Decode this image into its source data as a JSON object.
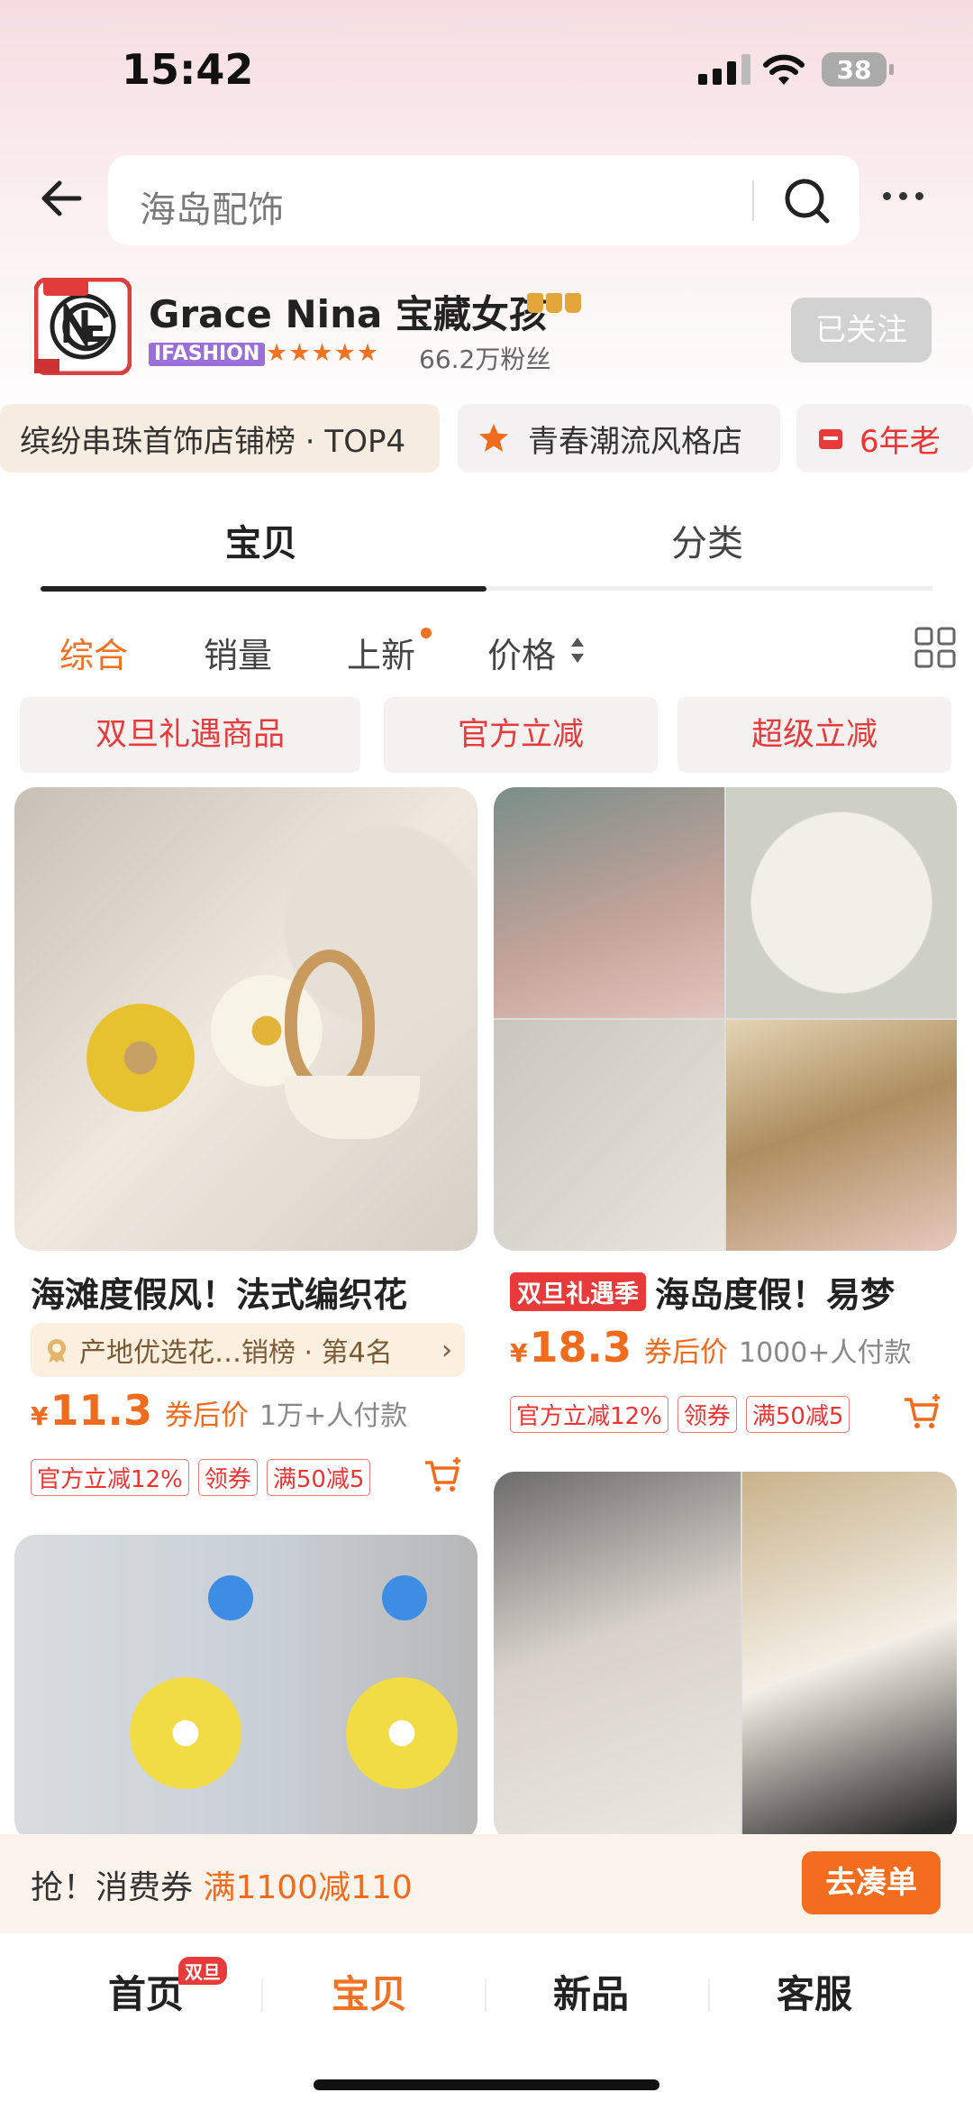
{
  "status_bar": {
    "time": "15:42",
    "battery": "38"
  },
  "search": {
    "query": "海岛配饰"
  },
  "shop": {
    "name": "Grace Nina 宝藏女孩",
    "platform_tag": "IFASHION",
    "stars": "★★★★★",
    "fans": "66.2万粉丝",
    "follow_label": "已关注"
  },
  "badges": [
    {
      "label": "缤纷串珠首饰店铺榜 · TOP4"
    },
    {
      "label": "青春潮流风格店",
      "icon": "star-icon"
    },
    {
      "label": "6年老",
      "icon": "store-icon"
    }
  ],
  "tabs": [
    {
      "label": "宝贝"
    },
    {
      "label": "分类"
    }
  ],
  "sort": {
    "zonghe": "综合",
    "xiaoliang": "销量",
    "shangxin": "上新",
    "jiage": "价格"
  },
  "promo_chips": [
    {
      "label": "双旦礼遇商品"
    },
    {
      "label": "官方立减"
    },
    {
      "label": "超级立减"
    }
  ],
  "products": [
    {
      "title": "海滩度假风！法式编织花",
      "rank": "产地优选花…销榜 · 第4名",
      "yen": "¥",
      "price": "11.3",
      "after_coupon": "券后价",
      "paid": "1万+人付款",
      "tags": [
        "官方立减12%",
        "领券",
        "满50减5"
      ]
    },
    {
      "tag": "双旦礼遇季",
      "title": "海岛度假！易梦",
      "yen": "¥",
      "price": "18.3",
      "after_coupon": "券后价",
      "paid": "1000+人付款",
      "tags": [
        "官方立减12%",
        "领券",
        "满50减5"
      ]
    }
  ],
  "coupon_bar": {
    "prefix": "抢！消费券",
    "amount": "满1100减110",
    "button": "去凑单"
  },
  "bottom_nav": {
    "home": "首页",
    "home_badge": "双旦",
    "items": "宝贝",
    "new": "新品",
    "service": "客服"
  },
  "colors": {
    "accent": "#f07222",
    "red": "#e83a3a"
  }
}
